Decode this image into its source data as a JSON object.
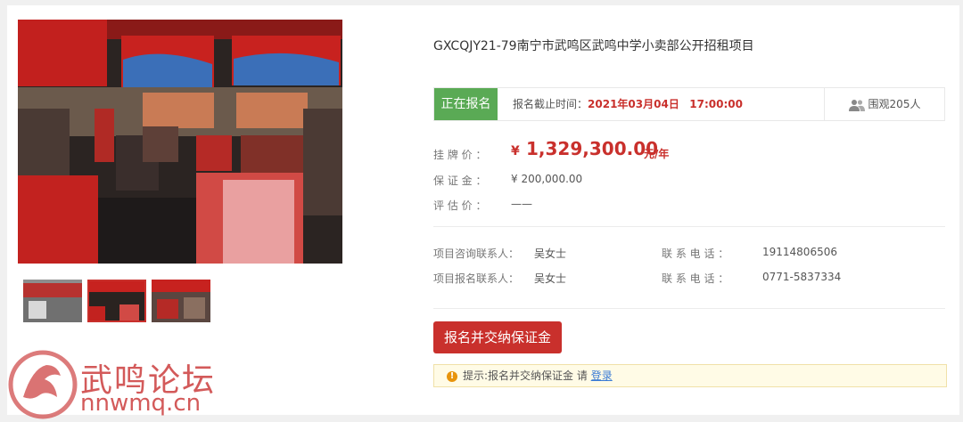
{
  "project": {
    "title": "GXCQJY21-79南宁市武鸣区武鸣中学小卖部公开招租项目"
  },
  "status": {
    "badge": "正在报名",
    "deadline_label": "报名截止时间：",
    "deadline_date": "2021年03月04日",
    "deadline_time": "17:00:00",
    "viewers": "围观205人"
  },
  "price": {
    "listing_label": "挂 牌 价 ：",
    "currency": "¥",
    "listing_value": "1,329,300.00",
    "listing_unit": "元/年",
    "deposit_label": "保 证 金 ：",
    "deposit_value": "¥ 200,000.00",
    "appraisal_label": "评 估 价 ：",
    "appraisal_value": "——"
  },
  "contacts": {
    "consult_label": "项目咨询联系人：",
    "consult_name": "吴女士",
    "phone_label_1": "联  系  电  话  ：",
    "phone_1": "19114806506",
    "signup_label": "项目报名联系人：",
    "signup_name": "吴女士",
    "phone_label_2": "联  系  电  话  ：",
    "phone_2": "0771-5837334"
  },
  "actions": {
    "signup_button": "报名并交纳保证金"
  },
  "tip": {
    "icon": "!",
    "text": "提示:报名并交纳保证金 请 ",
    "link": "登录"
  },
  "watermark": {
    "cn": "武鸣论坛",
    "en": "nnwmq.cn"
  },
  "colors": {
    "accent_red": "#c9302c",
    "status_green": "#5aaa55",
    "tip_bg": "#fffbe6"
  }
}
